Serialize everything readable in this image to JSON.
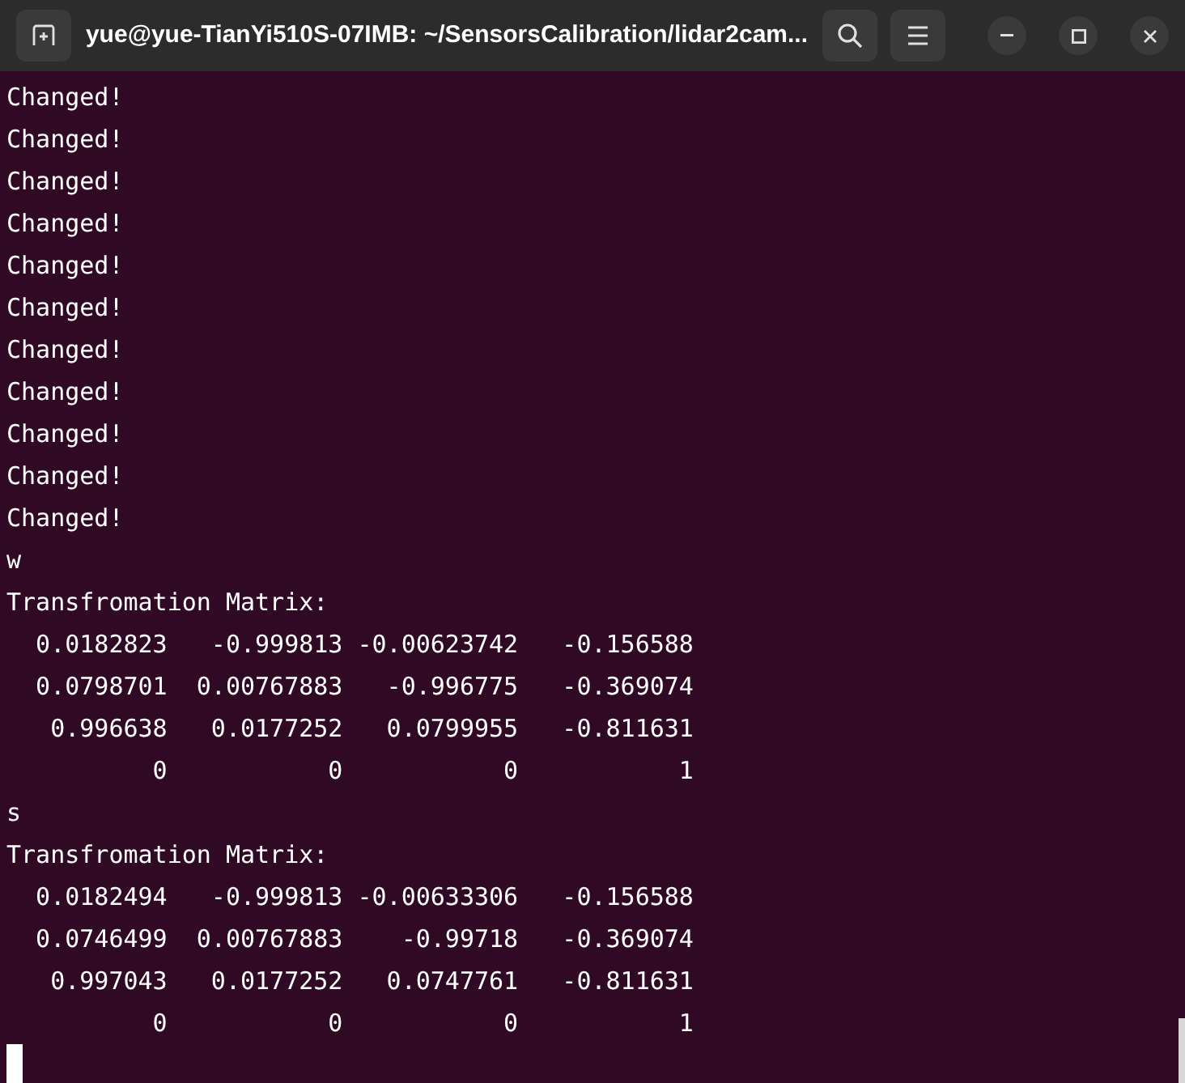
{
  "window": {
    "title": "yue@yue-TianYi510S-07IMB: ~/SensorsCalibration/lidar2cam..."
  },
  "terminal": {
    "lines": [
      "Changed!",
      "Changed!",
      "Changed!",
      "Changed!",
      "Changed!",
      "Changed!",
      "Changed!",
      "Changed!",
      "Changed!",
      "Changed!",
      "Changed!",
      "w",
      "Transfromation Matrix:",
      "  0.0182823   -0.999813 -0.00623742   -0.156588",
      "  0.0798701  0.00767883   -0.996775   -0.369074",
      "   0.996638   0.0177252   0.0799955   -0.811631",
      "          0           0           0           1",
      "s",
      "Transfromation Matrix:",
      "  0.0182494   -0.999813 -0.00633306   -0.156588",
      "  0.0746499  0.00767883    -0.99718   -0.369074",
      "   0.997043   0.0177252   0.0747761   -0.811631",
      "          0           0           0           1"
    ]
  }
}
